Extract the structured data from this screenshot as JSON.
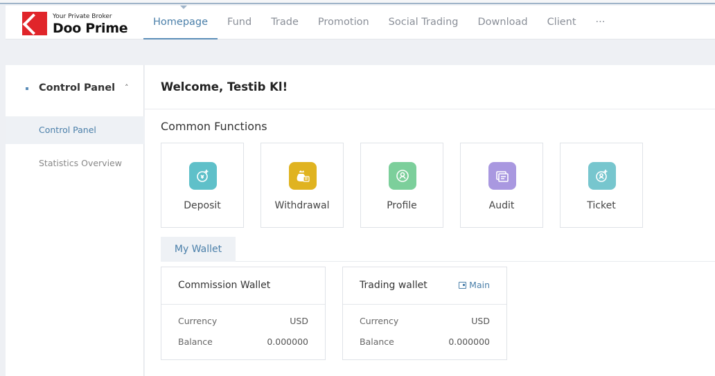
{
  "brand": {
    "tagline": "Your Private Broker",
    "name": "Doo Prime",
    "color": "#e0252a"
  },
  "nav": {
    "items": [
      {
        "label": "Homepage",
        "active": true
      },
      {
        "label": "Fund"
      },
      {
        "label": "Trade"
      },
      {
        "label": "Promotion"
      },
      {
        "label": "Social Trading"
      },
      {
        "label": "Download"
      },
      {
        "label": "Client"
      },
      {
        "label": "···"
      }
    ]
  },
  "sidebar": {
    "group_title": "Control Panel",
    "caret_icon": "chevron-up-icon",
    "items": [
      {
        "label": "Control Panel",
        "active": true
      },
      {
        "label": "Statistics Overview"
      }
    ]
  },
  "main": {
    "welcome": "Welcome, Testib Kl!",
    "common_functions_title": "Common Functions",
    "functions": [
      {
        "label": "Deposit",
        "icon": "deposit-icon",
        "color": "#5fc0c9"
      },
      {
        "label": "Withdrawal",
        "icon": "withdrawal-icon",
        "color": "#e0b320"
      },
      {
        "label": "Profile",
        "icon": "profile-icon",
        "color": "#7ccf9b"
      },
      {
        "label": "Audit",
        "icon": "audit-icon",
        "color": "#a998e0"
      },
      {
        "label": "Ticket",
        "icon": "ticket-icon",
        "color": "#77c6ce"
      }
    ],
    "wallet_tab": "My Wallet",
    "wallets": [
      {
        "title": "Commission Wallet",
        "currency_label": "Currency",
        "currency": "USD",
        "balance_label": "Balance",
        "balance": "0.000000"
      },
      {
        "title": "Trading wallet",
        "badge": "Main",
        "currency_label": "Currency",
        "currency": "USD",
        "balance_label": "Balance",
        "balance": "0.000000"
      }
    ]
  },
  "colors": {
    "accent": "#4a7fa9",
    "sidebar_active_bg": "#eef1f5"
  }
}
